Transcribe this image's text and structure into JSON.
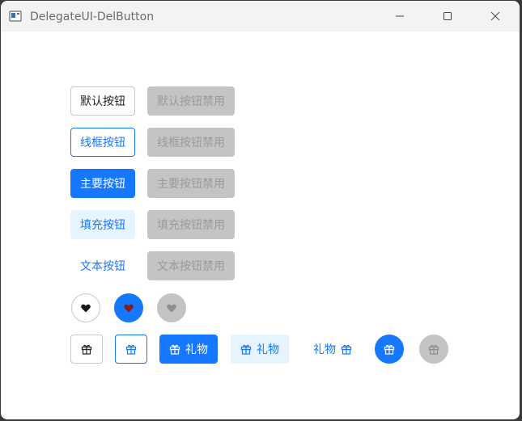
{
  "window": {
    "title": "DelegateUI-DelButton"
  },
  "rows": [
    {
      "label": "默认按钮",
      "disabled_label": "默认按钮禁用"
    },
    {
      "label": "线框按钮",
      "disabled_label": "线框按钮禁用"
    },
    {
      "label": "主要按钮",
      "disabled_label": "主要按钮禁用"
    },
    {
      "label": "填充按钮",
      "disabled_label": "填充按钮禁用"
    },
    {
      "label": "文本按钮",
      "disabled_label": "文本按钮禁用"
    }
  ],
  "icon_buttons": {
    "gift_label": "礼物"
  },
  "icons": {
    "heart": "heart-icon",
    "gift": "gift-icon"
  },
  "colors": {
    "primary": "#1677ff",
    "filled_bg": "#e6f4ff",
    "disabled_bg": "#c4c4c4",
    "heart_on_primary": "#8b1a1a"
  }
}
